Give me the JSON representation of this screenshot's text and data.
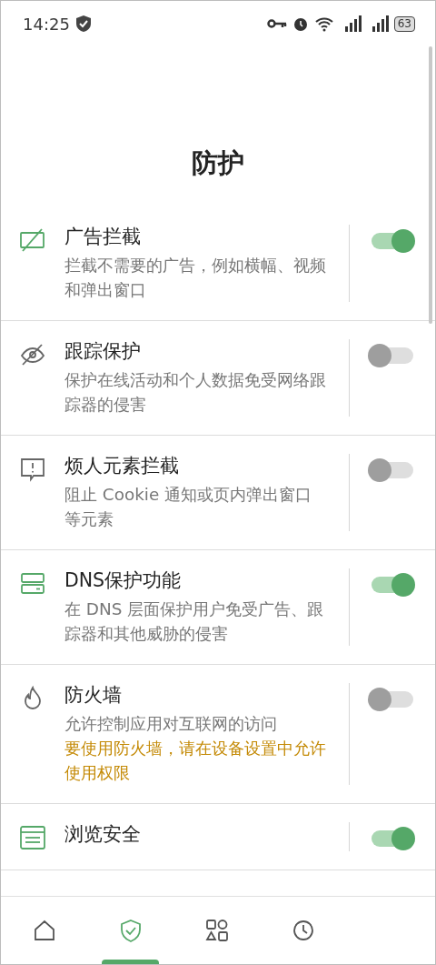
{
  "status_bar": {
    "time": "14:25",
    "battery": "63"
  },
  "title": "防护",
  "items": [
    {
      "kind": "ads",
      "title": "广告拦截",
      "description": "拦截不需要的广告，例如横幅、视频和弹出窗口",
      "on": true
    },
    {
      "kind": "tracking",
      "title": "跟踪保护",
      "description": "保护在线活动和个人数据免受网络跟踪器的侵害",
      "on": false
    },
    {
      "kind": "annoyance",
      "title": "烦人元素拦截",
      "description": "阻止 Cookie 通知或页内弹出窗口等元素",
      "on": false
    },
    {
      "kind": "dns",
      "title": "DNS保护功能",
      "description": "在 DNS 层面保护用户免受广告、跟踪器和其他威胁的侵害",
      "on": true
    },
    {
      "kind": "firewall",
      "title": "防火墙",
      "description": "允许控制应用对互联网的访问",
      "warning": "要使用防火墙，请在设备设置中允许使用权限",
      "on": false
    },
    {
      "kind": "browsing",
      "title": "浏览安全",
      "on": true
    }
  ],
  "nav": [
    {
      "kind": "home",
      "selected": false
    },
    {
      "kind": "protection",
      "selected": true
    },
    {
      "kind": "apps",
      "selected": false
    },
    {
      "kind": "activity",
      "selected": false
    }
  ]
}
